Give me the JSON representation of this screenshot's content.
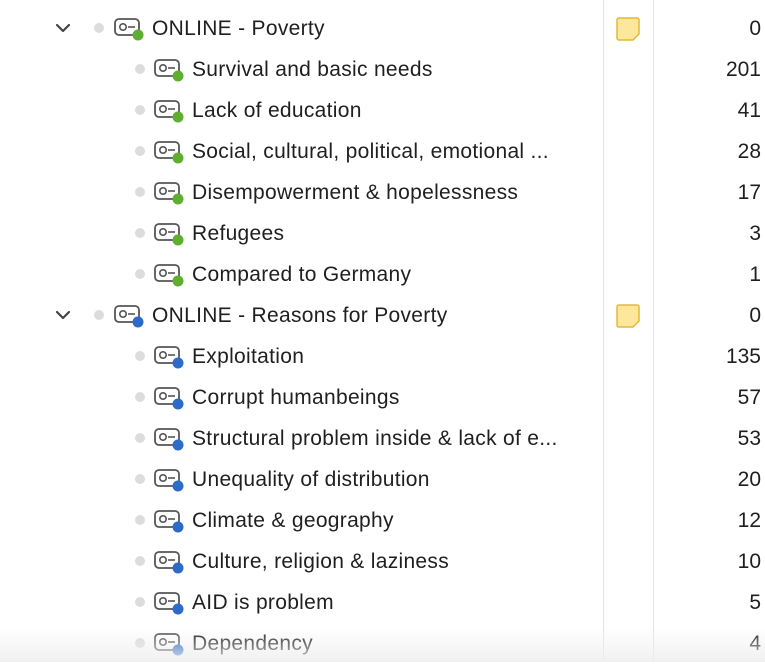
{
  "colors": {
    "poverty_code": "#5fae2f",
    "reasons_code": "#2c6bc7",
    "memo_fill": "#fde79a",
    "memo_stroke": "#e0b93c"
  },
  "groups": [
    {
      "label": "ONLINE - Poverty",
      "count": "0",
      "has_memo": true,
      "color_key": "poverty_code",
      "children": [
        {
          "label": "Survival and basic needs",
          "count": "201"
        },
        {
          "label": "Lack of education",
          "count": "41"
        },
        {
          "label": "Social, cultural, political, emotional ...",
          "count": "28"
        },
        {
          "label": "Disempowerment & hopelessness",
          "count": "17"
        },
        {
          "label": "Refugees",
          "count": "3"
        },
        {
          "label": "Compared to Germany",
          "count": "1"
        }
      ]
    },
    {
      "label": "ONLINE - Reasons for Poverty",
      "count": "0",
      "has_memo": true,
      "color_key": "reasons_code",
      "children": [
        {
          "label": "Exploitation",
          "count": "135"
        },
        {
          "label": "Corrupt humanbeings",
          "count": "57"
        },
        {
          "label": "Structural problem inside & lack of e...",
          "count": "53"
        },
        {
          "label": "Unequality of distribution",
          "count": "20"
        },
        {
          "label": "Climate & geography",
          "count": "12"
        },
        {
          "label": "Culture, religion & laziness",
          "count": "10"
        },
        {
          "label": "AID is problem",
          "count": "5"
        },
        {
          "label": "Dependency",
          "count": "4"
        }
      ]
    }
  ]
}
